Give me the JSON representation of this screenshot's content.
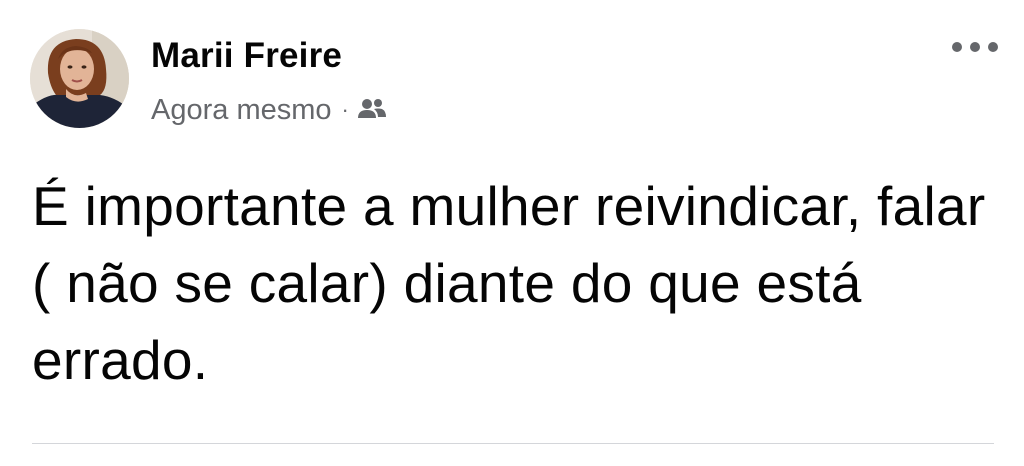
{
  "post": {
    "author": "Marii Freire",
    "timestamp": "Agora mesmo",
    "separator": "·",
    "audience_icon": "friends-icon",
    "more_icon": "more-options-icon",
    "text": "É importante a mulher reivindicar, falar ( não se calar) diante do que está errado."
  },
  "colors": {
    "text_primary": "#050505",
    "text_secondary": "#65676b",
    "divider": "#d4d6da"
  }
}
